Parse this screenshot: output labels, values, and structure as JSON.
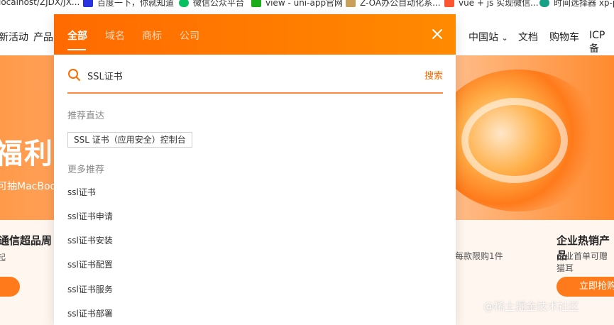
{
  "bookmarks": [
    {
      "label": "localhost/ZJDX/JX...",
      "icon": "page-icon",
      "color": "#888888"
    },
    {
      "label": "百度一下，你就知道",
      "icon": "baidu-paw-icon",
      "color": "#2932e1"
    },
    {
      "label": "微信公众平台",
      "icon": "wechat-icon",
      "color": "#07c160"
    },
    {
      "label": "view - uni-app官网",
      "icon": "uniapp-icon",
      "color": "#1aad19"
    },
    {
      "label": "Z-OA办公自动化系...",
      "icon": "zoa-icon",
      "color": "#c9a05a"
    },
    {
      "label": "vue + js 实现微信...",
      "icon": "csdn-icon",
      "color": "#fc5531"
    },
    {
      "label": "时间选择器 xp-pi",
      "icon": "plugin-icon",
      "color": "#16a085"
    }
  ],
  "nav": {
    "left_items": [
      "新活动",
      "产品"
    ],
    "right_items": [
      "中国站",
      "文档",
      "购物车",
      "ICP备"
    ]
  },
  "banner": {
    "title": "福利",
    "subtitle": "可抽MacBoo"
  },
  "cards": {
    "left_title": "通信超品周",
    "left_sub": "起",
    "mid_sub": "，每款限购1件",
    "right_title": "企业热销产品",
    "right_sub": "企业首单可赠猫耳",
    "right_button": "立即抢购"
  },
  "search_overlay": {
    "tabs": [
      "全部",
      "域名",
      "商标",
      "公司"
    ],
    "active_tab": "全部",
    "query": "SSL证书",
    "submit_label": "搜索",
    "recommend_label": "推荐直达",
    "quick_link": "SSL 证书（应用安全）控制台",
    "more_label": "更多推荐",
    "suggestions": [
      "ssl证书",
      "ssl证书申请",
      "ssl证书安装",
      "ssl证书配置",
      "ssl证书服务",
      "ssl证书部署"
    ]
  },
  "watermark": "@稀土掘金技术社区",
  "colors": {
    "accent": "#ff6a00",
    "accent_light": "#ff8a00"
  }
}
